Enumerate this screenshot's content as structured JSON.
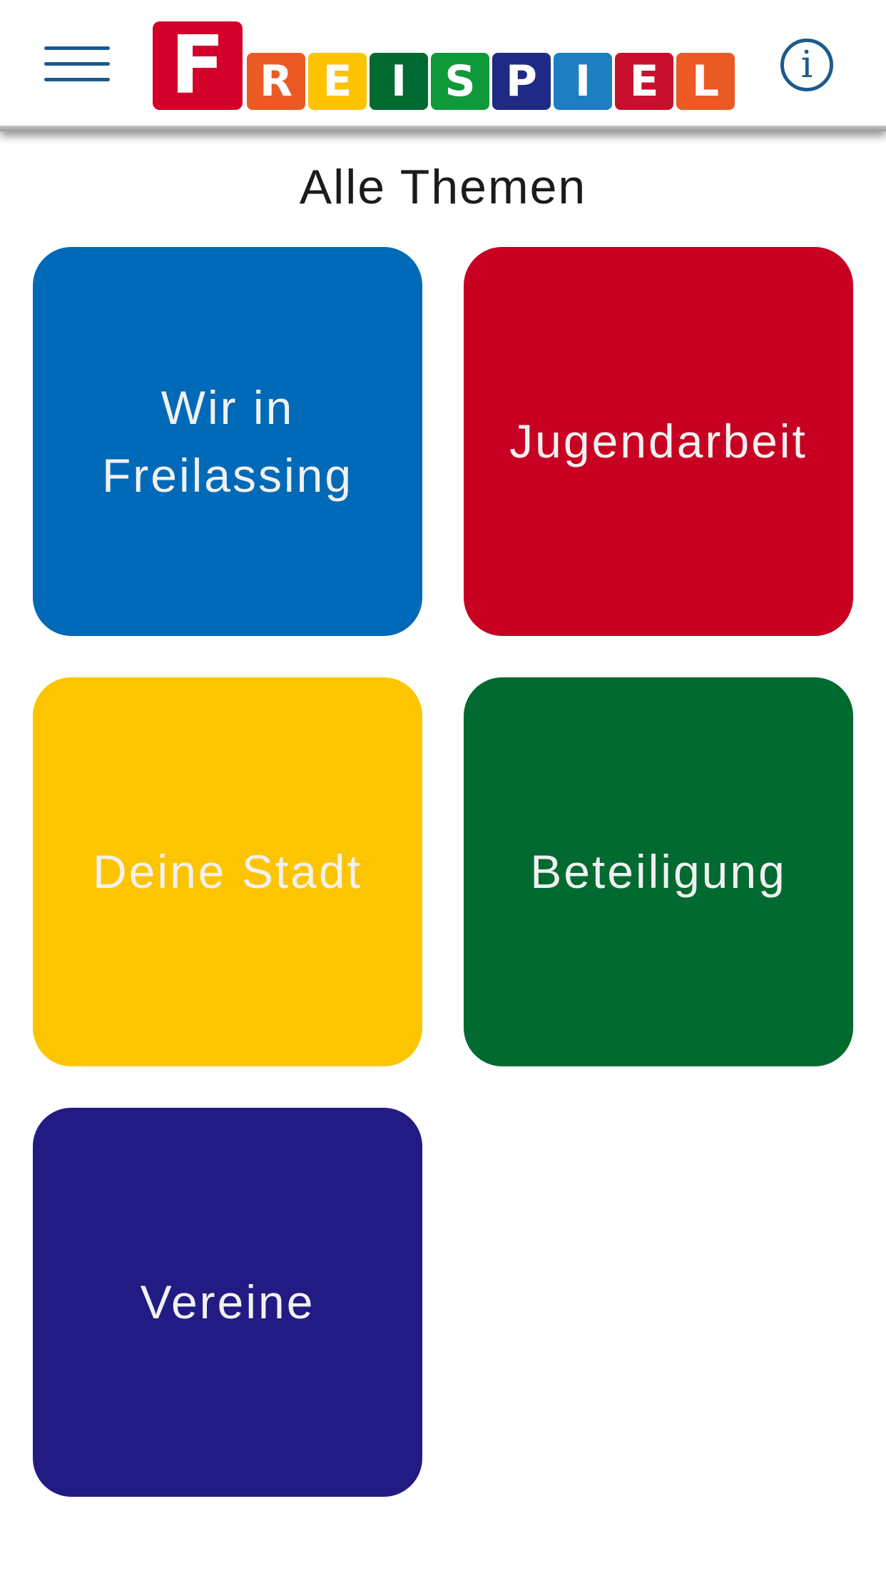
{
  "header": {
    "logo": {
      "text": "FREISPIEL",
      "letters": [
        {
          "char": "F",
          "color": "#d2002a"
        },
        {
          "char": "R",
          "color": "#ec5a24"
        },
        {
          "char": "E",
          "color": "#fdc300"
        },
        {
          "char": "I",
          "color": "#006a30"
        },
        {
          "char": "S",
          "color": "#0f9a3a"
        },
        {
          "char": "P",
          "color": "#1f2a85"
        },
        {
          "char": "I",
          "color": "#1d7ec1"
        },
        {
          "char": "E",
          "color": "#c8102e"
        },
        {
          "char": "L",
          "color": "#ec5a24"
        }
      ]
    },
    "menu_icon": "hamburger-menu-icon",
    "info_icon": "info-circle-icon",
    "info_glyph": "i"
  },
  "page": {
    "title": "Alle Themen"
  },
  "topics": [
    {
      "label": "Wir in\nFreilassing",
      "color": "#006ab8"
    },
    {
      "label": "Jugendarbeit",
      "color": "#c80021"
    },
    {
      "label": "Deine Stadt",
      "color": "#fdc500"
    },
    {
      "label": "Beteiligung",
      "color": "#006a30"
    },
    {
      "label": "Vereine",
      "color": "#221b83"
    }
  ],
  "colors": {
    "accent": "#1b5b8c",
    "title_text": "#1b1b1b",
    "tile_text": "#f1f1f1"
  }
}
